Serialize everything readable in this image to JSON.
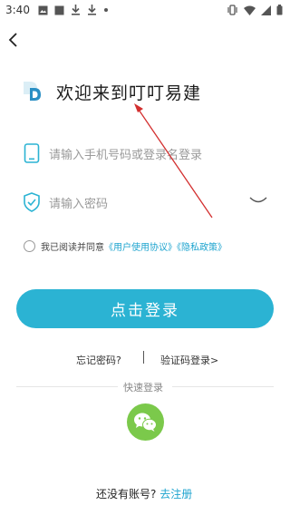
{
  "status_bar": {
    "time": "3:40",
    "left_icons": [
      "image-icon",
      "square-icon",
      "download-icon",
      "download-icon",
      "dot-icon"
    ],
    "right_icons": [
      "vibrate-icon",
      "wifi-icon",
      "signal-icon",
      "battery-icon"
    ]
  },
  "header": {
    "back_icon": "chevron-left-icon",
    "welcome_title": "欢迎来到叮叮易建"
  },
  "form": {
    "phone": {
      "placeholder": "请输入手机号码或登录名登录",
      "value": "",
      "icon": "phone-icon"
    },
    "password": {
      "placeholder": "请输入密码",
      "value": "",
      "icon": "shield-check-icon",
      "toggle_icon": "eye-closed-icon"
    }
  },
  "agreement": {
    "checked": false,
    "prefix": "我已阅读并同意",
    "user_agreement": "《用户使用协议》",
    "privacy_policy": "《隐私政策》"
  },
  "login_button": {
    "label": "点击登录"
  },
  "links": {
    "forgot_password": "忘记密码?",
    "code_login": "验证码登录>"
  },
  "quick_login": {
    "label": "快速登录",
    "wechat_icon": "wechat-icon"
  },
  "register": {
    "prompt": "还没有账号?",
    "link": "去注册"
  },
  "colors": {
    "accent": "#2bb3d3",
    "link": "#1ea4cf",
    "wechat": "#7bc94b",
    "annotation_arrow": "#d32f2f"
  }
}
